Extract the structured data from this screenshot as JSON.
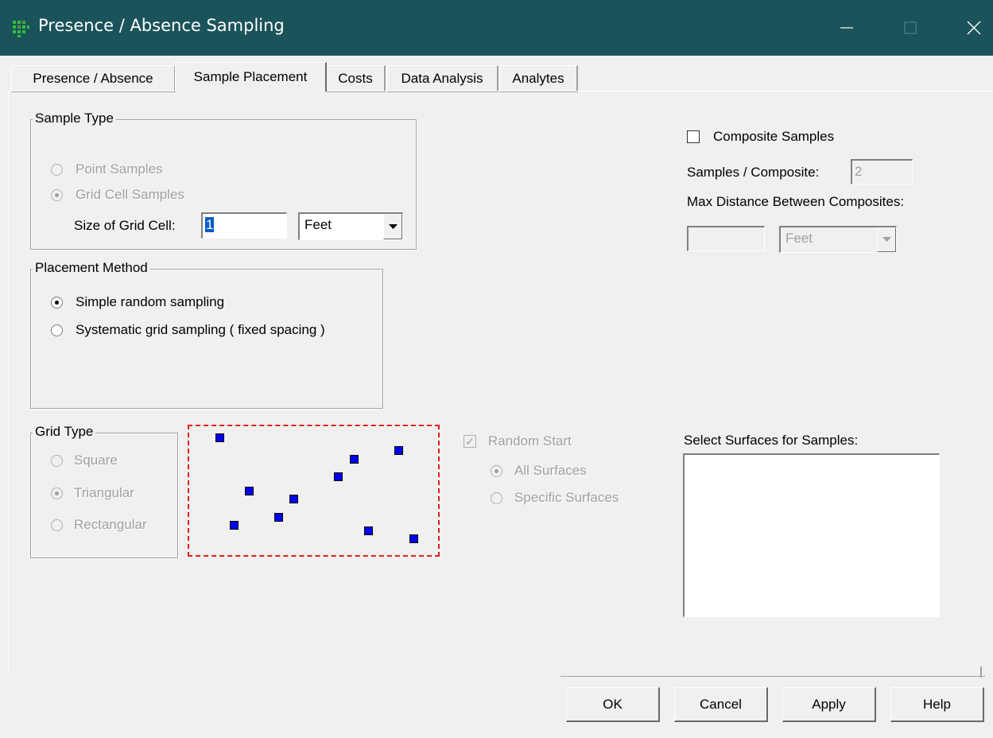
{
  "window": {
    "title": "Presence / Absence Sampling"
  },
  "tabs": [
    {
      "label": "Presence / Absence"
    },
    {
      "label": "Sample Placement",
      "active": true
    },
    {
      "label": "Costs"
    },
    {
      "label": "Data Analysis"
    },
    {
      "label": "Analytes"
    }
  ],
  "sample_type": {
    "legend": "Sample Type",
    "point_label": "Point Samples",
    "grid_label": "Grid Cell Samples",
    "selected": "Grid Cell Samples",
    "size_label": "Size of Grid Cell:",
    "size_value": "1",
    "unit_value": "Feet"
  },
  "composite": {
    "checkbox_label": "Composite Samples",
    "checked": false,
    "samples_label": "Samples / Composite:",
    "samples_value": "2",
    "max_distance_label": "Max Distance Between Composites:",
    "distance_value": "",
    "unit_value": "Feet"
  },
  "placement_method": {
    "legend": "Placement Method",
    "simple_label": "Simple random sampling",
    "systematic_label": "Systematic grid sampling ( fixed spacing )",
    "selected": "Simple random sampling"
  },
  "grid_type": {
    "legend": "Grid Type",
    "square_label": "Square",
    "triangular_label": "Triangular",
    "rectangular_label": "Rectangular",
    "selected": "Triangular"
  },
  "random_start": {
    "label": "Random Start",
    "checked": true,
    "all_label": "All Surfaces",
    "specific_label": "Specific Surfaces",
    "selected": "All Surfaces"
  },
  "surfaces": {
    "label": "Select Surfaces for Samples:",
    "items": []
  },
  "buttons": {
    "ok": "OK",
    "cancel": "Cancel",
    "apply": "Apply",
    "help": "Help"
  },
  "colors": {
    "titlebar": "#1b535b",
    "sample_marker": "#0000ee",
    "preview_border": "#e02020"
  }
}
